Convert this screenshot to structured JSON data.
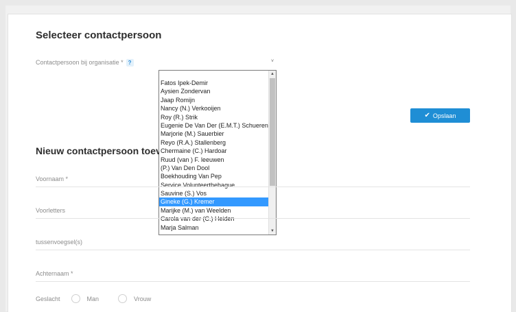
{
  "form": {
    "title": "Selecteer contactpersoon",
    "contact_label": "Contactpersoon bij organisatie *",
    "help_icon_text": "?",
    "caret": "˅"
  },
  "dropdown": {
    "items": [
      "Fatos Ipek-Demir",
      "Aysien Zondervan",
      "Jaap Romijn",
      "Nancy (N.) Verkooijen",
      "Roy (R.) Strik",
      "Eugenie De Van Der (E.M.T.) Schueren",
      "Marjorie (M.) Sauerbier",
      "Reyo (R.A.) Stallenberg",
      "Chermaine (C.) Hardoar",
      "Ruud (van ) F. leeuwen",
      "(P.) Van Den Dool",
      "Boekhouding Van Pep",
      "Service Volunteerthehague",
      "Sauvine (S.) Vos",
      "Gineke (G.) Kremer",
      "Marijke (M.) van Weelden",
      "Carola van der (C.) Heiden",
      "Marja Salman"
    ],
    "selected_index": 14
  },
  "save_button": {
    "label": "Opslaan",
    "icon": "check-icon"
  },
  "new_contact": {
    "title": "Nieuw contactpersoon toevo",
    "fields": {
      "first_name": "Voornaam *",
      "initials": "Voorletters",
      "infix": "tussenvoegsel(s)",
      "last_name": "Achternaam *"
    },
    "gender_label": "Geslacht",
    "gender_male": "Man",
    "gender_female": "Vrouw"
  },
  "colors": {
    "accent": "#1f8ed5",
    "selection": "#3399ff"
  }
}
